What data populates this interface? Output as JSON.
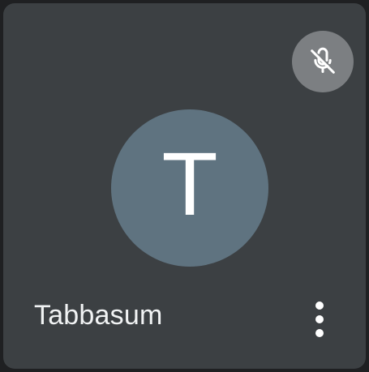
{
  "participant": {
    "name": "Tabbasum",
    "initial": "T",
    "microphone": "muted"
  },
  "icons": {
    "mic_status": "mic-off-icon",
    "options": "more-vert-icon"
  },
  "colors": {
    "tile_background": "#3c4043",
    "avatar_background": "#5f7380",
    "mute_badge_background": "#7c7f82",
    "text": "#ffffff"
  }
}
